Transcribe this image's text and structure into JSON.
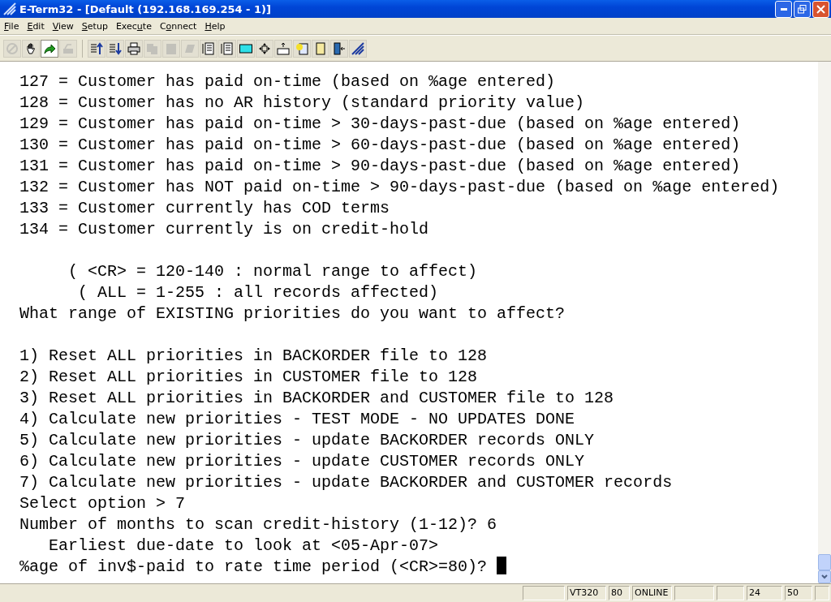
{
  "window": {
    "title": "E-Term32 - [Default (192.168.169.254 - 1)]"
  },
  "menu": [
    {
      "key": "F",
      "post": "ile"
    },
    {
      "key": "E",
      "post": "dit"
    },
    {
      "key": "V",
      "post": "iew"
    },
    {
      "key": "S",
      "post": "etup"
    },
    {
      "pre": "Exec",
      "key": "u",
      "post": "te"
    },
    {
      "pre": "C",
      "key": "o",
      "post": "nnect"
    },
    {
      "key": "H",
      "post": "elp"
    }
  ],
  "toolbar": [
    [
      {
        "kind": "stop",
        "disabled": true,
        "pressed": false
      },
      {
        "kind": "hand",
        "disabled": false,
        "pressed": false
      },
      {
        "kind": "arrow",
        "disabled": false,
        "pressed": true
      },
      {
        "kind": "machine",
        "disabled": true,
        "pressed": false
      }
    ],
    [
      {
        "kind": "upload",
        "disabled": false,
        "pressed": false
      },
      {
        "kind": "download",
        "disabled": false,
        "pressed": false
      },
      {
        "kind": "printer",
        "disabled": false,
        "pressed": false
      },
      {
        "kind": "copy",
        "disabled": true,
        "pressed": false
      },
      {
        "kind": "paste",
        "disabled": true,
        "pressed": false
      },
      {
        "kind": "slant",
        "disabled": true,
        "pressed": false
      },
      {
        "kind": "page",
        "disabled": false,
        "pressed": false
      },
      {
        "kind": "page",
        "disabled": false,
        "pressed": false
      },
      {
        "kind": "columns",
        "disabled": false,
        "pressed": false
      },
      {
        "kind": "move",
        "disabled": false,
        "pressed": false
      },
      {
        "kind": "keyboard",
        "disabled": false,
        "pressed": false
      },
      {
        "kind": "help",
        "disabled": false,
        "pressed": false
      },
      {
        "kind": "phone",
        "disabled": false,
        "pressed": false
      },
      {
        "kind": "exit",
        "disabled": false,
        "pressed": false
      },
      {
        "kind": "logo",
        "disabled": false,
        "pressed": false
      }
    ]
  ],
  "terminal": {
    "cursor": true,
    "blocks": [
      [
        "127 = Customer has paid on-time (based on %age entered)",
        "128 = Customer has no AR history (standard priority value)",
        "129 = Customer has paid on-time > 30-days-past-due (based on %age entered)",
        "130 = Customer has paid on-time > 60-days-past-due (based on %age entered)",
        "131 = Customer has paid on-time > 90-days-past-due (based on %age entered)",
        "132 = Customer has NOT paid on-time > 90-days-past-due (based on %age entered)",
        "133 = Customer currently has COD terms",
        "134 = Customer currently is on credit-hold"
      ],
      [
        "     ( <CR> = 120-140 : normal range to affect)",
        "      ( ALL = 1-255 : all records affected)",
        "What range of EXISTING priorities do you want to affect?"
      ],
      [
        "1) Reset ALL priorities in BACKORDER file to 128",
        "2) Reset ALL priorities in CUSTOMER file to 128",
        "3) Reset ALL priorities in BACKORDER and CUSTOMER file to 128",
        "4) Calculate new priorities - TEST MODE - NO UPDATES DONE",
        "5) Calculate new priorities - update BACKORDER records ONLY",
        "6) Calculate new priorities - update CUSTOMER records ONLY",
        "7) Calculate new priorities - update BACKORDER and CUSTOMER records",
        "Select option > 7",
        "Number of months to scan credit-history (1-12)? 6",
        "   Earliest due-date to look at <05-Apr-07>",
        "%age of inv$-paid to rate time period (<CR>=80)? "
      ]
    ]
  },
  "status_bar": [
    {
      "kind": "blank"
    },
    {
      "kind": "text",
      "text": "VT320"
    },
    {
      "kind": "text",
      "text": "80"
    },
    {
      "kind": "text",
      "text": "ONLINE"
    },
    {
      "kind": "blank"
    },
    {
      "kind": "blank"
    },
    {
      "kind": "text",
      "text": "24"
    },
    {
      "kind": "text",
      "text": "50"
    },
    {
      "kind": "blank"
    }
  ]
}
